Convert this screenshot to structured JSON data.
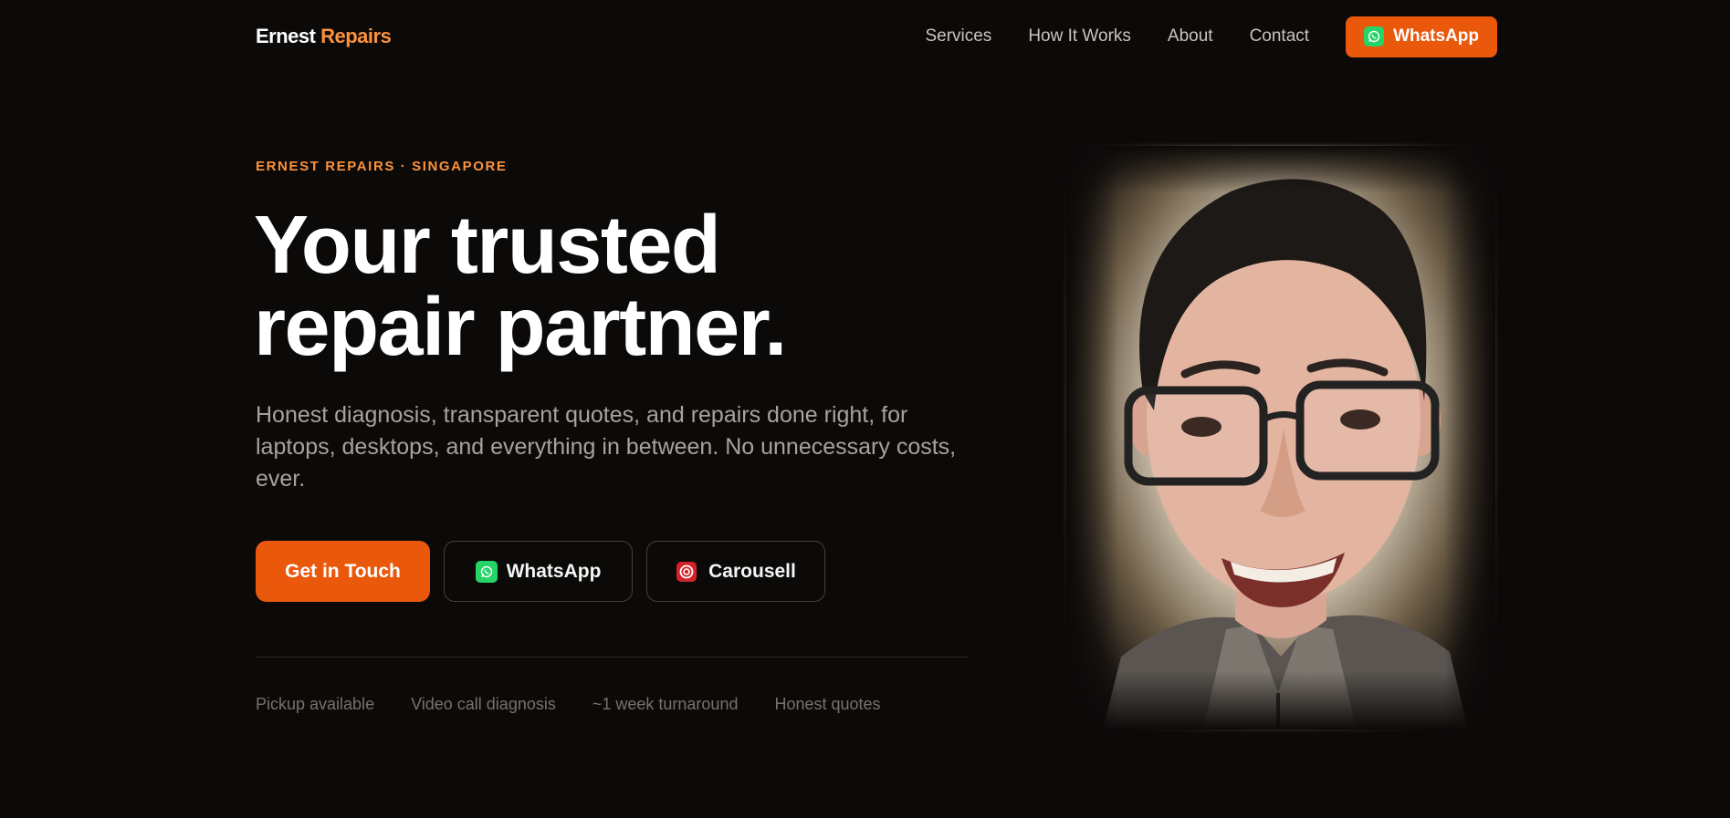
{
  "brand": {
    "first": "Ernest",
    "second": "Repairs"
  },
  "nav": {
    "links": [
      "Services",
      "How It Works",
      "About",
      "Contact"
    ],
    "whatsapp_label": "WhatsApp"
  },
  "hero": {
    "eyebrow": "ERNEST REPAIRS · SINGAPORE",
    "headline_line1": "Your trusted",
    "headline_line2": "repair partner.",
    "subtext": "Honest diagnosis, transparent quotes, and repairs done right, for laptops, desktops, and everything in between. No unnecessary costs, ever.",
    "buttons": {
      "primary": "Get in Touch",
      "whatsapp": "WhatsApp",
      "carousell": "Carousell"
    },
    "features": [
      "Pickup available",
      "Video call diagnosis",
      "~1 week turnaround",
      "Honest quotes"
    ]
  },
  "icons": {
    "whatsapp": "whatsapp-icon",
    "carousell": "carousell-icon"
  },
  "colors": {
    "background": "#0c0a09",
    "accent": "#ea580c",
    "accent_text": "#fb923c",
    "whatsapp_green": "#25d366",
    "carousell_red": "#d2232a"
  }
}
